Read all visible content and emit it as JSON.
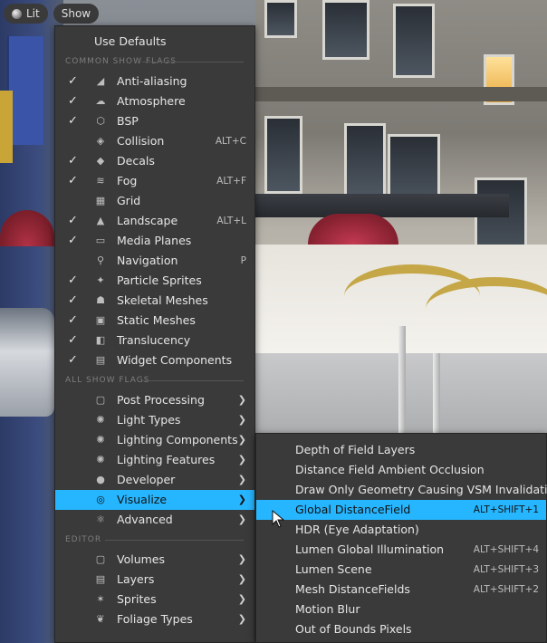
{
  "toolbar": {
    "view_mode_label": "Lit",
    "show_label": "Show"
  },
  "main_menu": {
    "use_defaults": "Use Defaults",
    "sections": {
      "common": "COMMON SHOW FLAGS",
      "all": "ALL SHOW FLAGS",
      "editor": "EDITOR"
    },
    "common_flags": [
      {
        "label": "Anti-aliasing",
        "checked": true,
        "icon": "anti-aliasing-icon",
        "shortcut": ""
      },
      {
        "label": "Atmosphere",
        "checked": true,
        "icon": "atmosphere-icon",
        "shortcut": ""
      },
      {
        "label": "BSP",
        "checked": true,
        "icon": "bsp-icon",
        "shortcut": ""
      },
      {
        "label": "Collision",
        "checked": false,
        "icon": "collision-icon",
        "shortcut": "ALT+C"
      },
      {
        "label": "Decals",
        "checked": true,
        "icon": "decals-icon",
        "shortcut": ""
      },
      {
        "label": "Fog",
        "checked": true,
        "icon": "fog-icon",
        "shortcut": "ALT+F"
      },
      {
        "label": "Grid",
        "checked": false,
        "icon": "grid-icon",
        "shortcut": ""
      },
      {
        "label": "Landscape",
        "checked": true,
        "icon": "landscape-icon",
        "shortcut": "ALT+L"
      },
      {
        "label": "Media Planes",
        "checked": true,
        "icon": "media-planes-icon",
        "shortcut": ""
      },
      {
        "label": "Navigation",
        "checked": false,
        "icon": "navigation-icon",
        "shortcut": "P"
      },
      {
        "label": "Particle Sprites",
        "checked": true,
        "icon": "particle-sprites-icon",
        "shortcut": ""
      },
      {
        "label": "Skeletal Meshes",
        "checked": true,
        "icon": "skeletal-meshes-icon",
        "shortcut": ""
      },
      {
        "label": "Static Meshes",
        "checked": true,
        "icon": "static-meshes-icon",
        "shortcut": ""
      },
      {
        "label": "Translucency",
        "checked": true,
        "icon": "translucency-icon",
        "shortcut": ""
      },
      {
        "label": "Widget Components",
        "checked": true,
        "icon": "widget-components-icon",
        "shortcut": ""
      }
    ],
    "all_flags": [
      {
        "label": "Post Processing",
        "icon": "post-processing-icon"
      },
      {
        "label": "Light Types",
        "icon": "light-types-icon"
      },
      {
        "label": "Lighting Components",
        "icon": "lighting-components-icon"
      },
      {
        "label": "Lighting Features",
        "icon": "lighting-features-icon"
      },
      {
        "label": "Developer",
        "icon": "developer-icon"
      },
      {
        "label": "Visualize",
        "icon": "visualize-icon",
        "highlighted": true
      },
      {
        "label": "Advanced",
        "icon": "advanced-icon"
      }
    ],
    "editor_flags": [
      {
        "label": "Volumes",
        "icon": "volumes-icon"
      },
      {
        "label": "Layers",
        "icon": "layers-icon"
      },
      {
        "label": "Sprites",
        "icon": "sprites-icon"
      },
      {
        "label": "Foliage Types",
        "icon": "foliage-types-icon"
      }
    ]
  },
  "visualize_menu": {
    "items": [
      {
        "label": "Depth of Field Layers",
        "shortcut": ""
      },
      {
        "label": "Distance Field Ambient Occlusion",
        "shortcut": ""
      },
      {
        "label": "Draw Only Geometry Causing VSM Invalidation",
        "shortcut": ""
      },
      {
        "label": "Global DistanceField",
        "shortcut": "ALT+SHIFT+1",
        "highlighted": true
      },
      {
        "label": "HDR (Eye Adaptation)",
        "shortcut": ""
      },
      {
        "label": "Lumen Global Illumination",
        "shortcut": "ALT+SHIFT+4"
      },
      {
        "label": "Lumen Scene",
        "shortcut": "ALT+SHIFT+3"
      },
      {
        "label": "Mesh DistanceFields",
        "shortcut": "ALT+SHIFT+2"
      },
      {
        "label": "Motion Blur",
        "shortcut": ""
      },
      {
        "label": "Out of Bounds Pixels",
        "shortcut": ""
      }
    ]
  },
  "colors": {
    "menu_bg": "#3a3a3a",
    "highlight": "#26b6ff"
  }
}
